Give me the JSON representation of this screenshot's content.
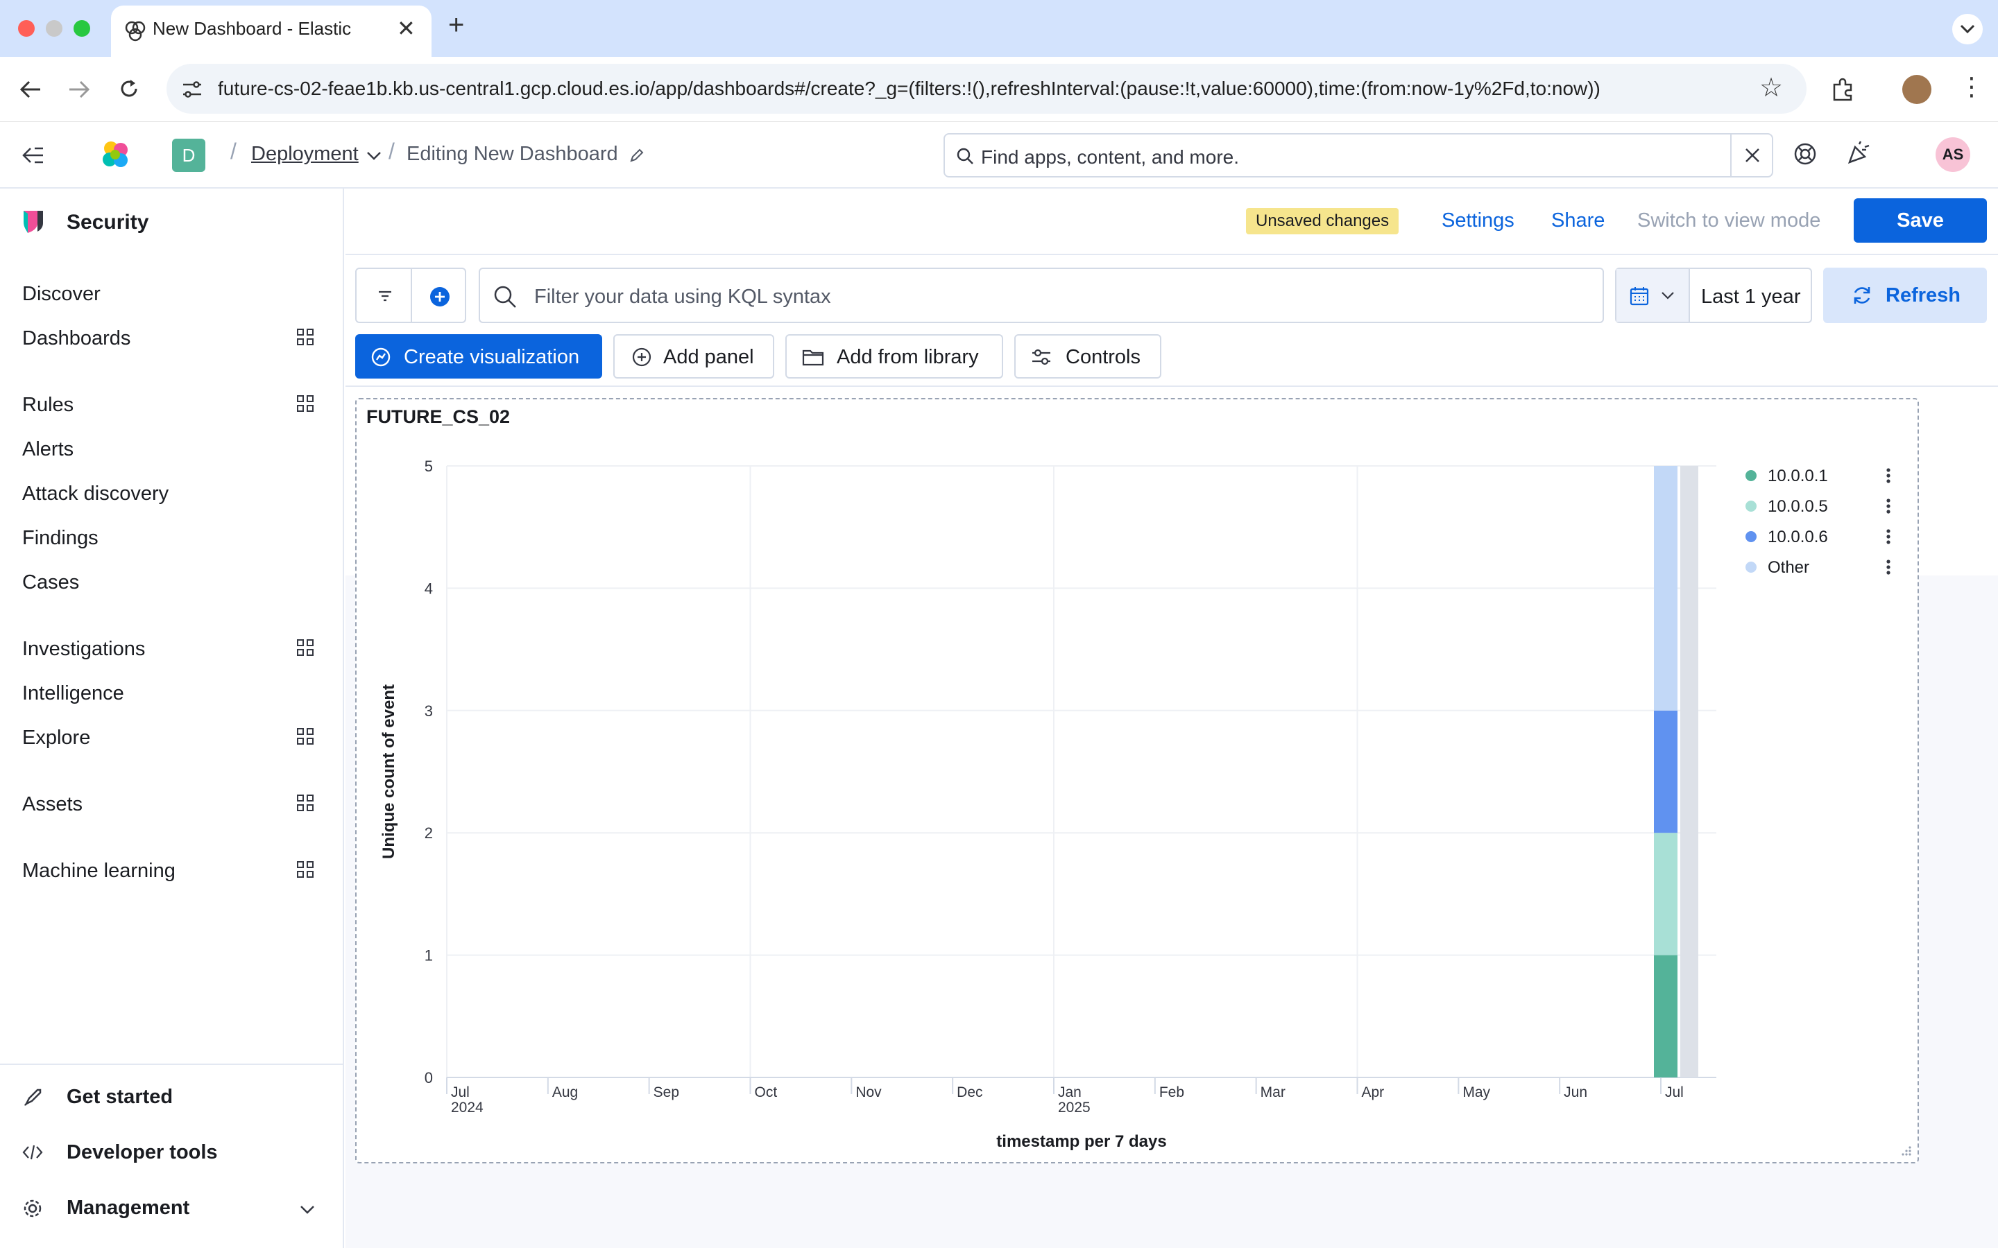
{
  "browser": {
    "tab_title": "New Dashboard - Elastic",
    "url": "future-cs-02-feae1b.kb.us-central1.gcp.cloud.es.io/app/dashboards#/create?_g=(filters:!(),refreshInterval:(pause:!t,value:60000),time:(from:now-1y%2Fd,to:now))"
  },
  "header": {
    "space_badge": "D",
    "breadcrumb_deployment": "Deployment",
    "breadcrumb_current": "Editing New Dashboard",
    "search_placeholder": "Find apps, content, and more.",
    "avatar_initials": "AS"
  },
  "sidebar": {
    "solution_title": "Security",
    "items": [
      {
        "label": "Discover"
      },
      {
        "label": "Dashboards"
      },
      {
        "label": "Rules"
      },
      {
        "label": "Alerts"
      },
      {
        "label": "Attack discovery"
      },
      {
        "label": "Findings"
      },
      {
        "label": "Cases"
      },
      {
        "label": "Investigations"
      },
      {
        "label": "Intelligence"
      },
      {
        "label": "Explore"
      },
      {
        "label": "Assets"
      },
      {
        "label": "Machine learning"
      }
    ],
    "footer": {
      "get_started": "Get started",
      "developer_tools": "Developer tools",
      "management": "Management"
    }
  },
  "topnav": {
    "unsaved_badge": "Unsaved changes",
    "settings": "Settings",
    "share": "Share",
    "switch_view": "Switch to view mode",
    "save": "Save"
  },
  "query": {
    "kql_placeholder": "Filter your data using KQL syntax",
    "time_range": "Last 1 year",
    "refresh": "Refresh"
  },
  "toolbar": {
    "create_visualization": "Create visualization",
    "add_panel": "Add panel",
    "add_from_library": "Add from library",
    "controls": "Controls"
  },
  "panel": {
    "title": "FUTURE_CS_02"
  },
  "colors": {
    "primary": "#0b64dd",
    "unsaved_bg": "#f6e58d",
    "series_1": "#54b399",
    "series_2": "#a8e0d6",
    "series_3": "#6092f0",
    "series_4": "#c2d8f7"
  },
  "chart_data": {
    "type": "bar",
    "stacked": true,
    "xlabel": "timestamp per 7 days",
    "ylabel": "Unique count of event",
    "ylim": [
      0,
      5
    ],
    "y_ticks": [
      "0",
      "1",
      "2",
      "3",
      "4",
      "5"
    ],
    "x_ticks": [
      {
        "label": "Jul",
        "sub": "2024"
      },
      {
        "label": "Aug",
        "sub": ""
      },
      {
        "label": "Sep",
        "sub": ""
      },
      {
        "label": "Oct",
        "sub": ""
      },
      {
        "label": "Nov",
        "sub": ""
      },
      {
        "label": "Dec",
        "sub": ""
      },
      {
        "label": "Jan",
        "sub": "2025"
      },
      {
        "label": "Feb",
        "sub": ""
      },
      {
        "label": "Mar",
        "sub": ""
      },
      {
        "label": "Apr",
        "sub": ""
      },
      {
        "label": "May",
        "sub": ""
      },
      {
        "label": "Jun",
        "sub": ""
      },
      {
        "label": "Jul",
        "sub": ""
      }
    ],
    "grid": true,
    "legend_position": "right",
    "categories": [
      "Jul 2025 week"
    ],
    "series": [
      {
        "name": "10.0.0.1",
        "values": [
          1
        ],
        "color": "#54b399"
      },
      {
        "name": "10.0.0.5",
        "values": [
          1
        ],
        "color": "#a8e0d6"
      },
      {
        "name": "10.0.0.6",
        "values": [
          1
        ],
        "color": "#6092f0"
      },
      {
        "name": "Other",
        "values": [
          2
        ],
        "color": "#c2d8f7"
      }
    ]
  }
}
